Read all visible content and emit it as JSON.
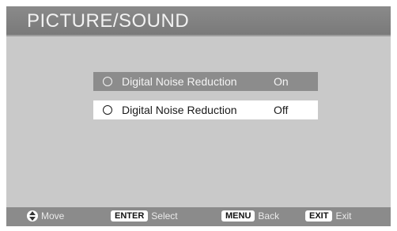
{
  "menu": {
    "title": "PICTURE/SOUND"
  },
  "options": [
    {
      "label": "Digital Noise Reduction",
      "value": "On",
      "state": "highlighted"
    },
    {
      "label": "Digital Noise Reduction",
      "value": "Off",
      "state": "selected"
    }
  ],
  "footer": {
    "move": {
      "icon": "up-down-arrow-icon",
      "label": "Move"
    },
    "enter": {
      "key": "ENTER",
      "label": "Select"
    },
    "menu": {
      "key": "MENU",
      "label": "Back"
    },
    "exit": {
      "key": "EXIT",
      "label": "Exit"
    }
  },
  "colors": {
    "background": "#c9c9c9",
    "title_bar": "#7a7a7a",
    "highlight": "#8c8c8c",
    "selected": "#ffffff"
  }
}
